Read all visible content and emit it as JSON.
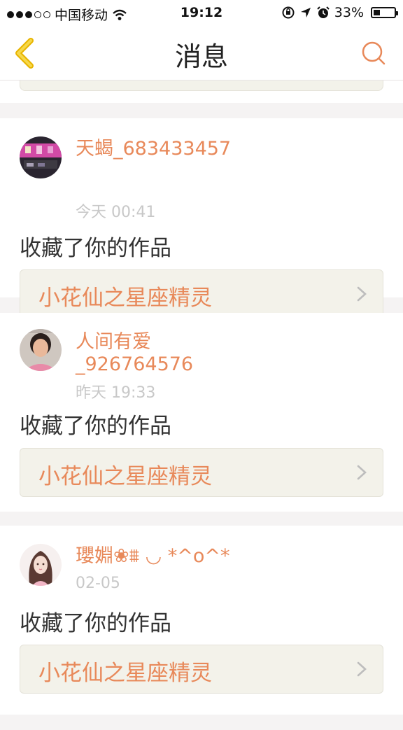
{
  "status_bar": {
    "signal": "●●●○○",
    "carrier": "中国移动",
    "time": "19:12",
    "battery_percent": "33%",
    "battery_level": 0.33,
    "icons": [
      "wifi-icon",
      "orientation-lock-icon",
      "location-arrow-icon",
      "alarm-icon",
      "battery-icon"
    ]
  },
  "nav": {
    "title": "消息",
    "back_icon": "chevron-left-icon",
    "search_icon": "search-icon",
    "accent_color": "#e8895a"
  },
  "messages": [
    {
      "username": "天蝎_683433457",
      "time": "今天 00:41",
      "action": "收藏了你的作品",
      "work_title": "小花仙之星座精灵"
    },
    {
      "username": "人间有爱_926764576",
      "time": "昨天 19:33",
      "action": "收藏了你的作品",
      "work_title": "小花仙之星座精灵"
    },
    {
      "username": "瓔婣❀⩩ ◡ *^o^*",
      "time": "02-05",
      "action": "收藏了你的作品",
      "work_title": "小花仙之星座精灵"
    }
  ]
}
